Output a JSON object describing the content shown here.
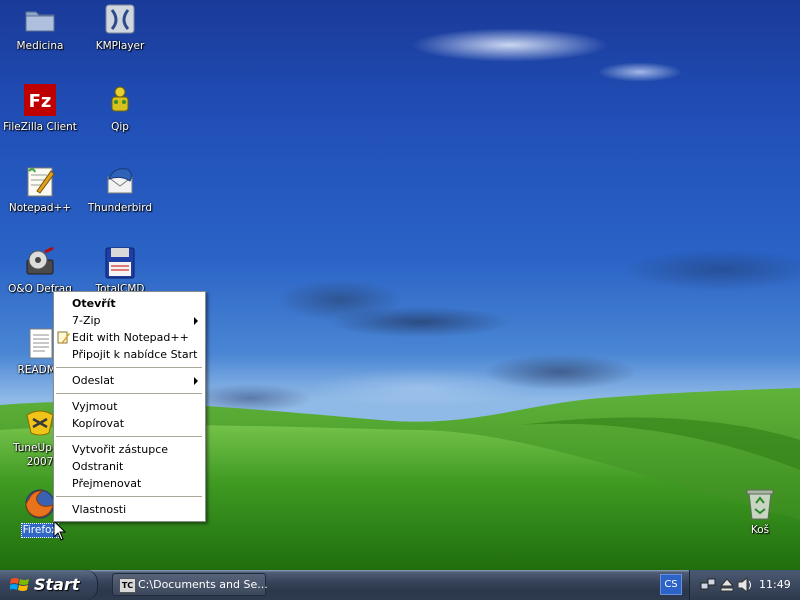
{
  "desktop": {
    "icons": [
      {
        "label": "Medicina",
        "icon": "folder-icon"
      },
      {
        "label": "KMPlayer",
        "icon": "kmplayer-icon"
      },
      {
        "label": "FileZilla Client",
        "icon": "filezilla-icon"
      },
      {
        "label": "Qip",
        "icon": "qip-icon"
      },
      {
        "label": "Notepad++",
        "icon": "notepad-plus-plus-icon"
      },
      {
        "label": "Thunderbird",
        "icon": "thunderbird-icon"
      },
      {
        "label": "O&O Defrag",
        "icon": "defrag-icon"
      },
      {
        "label": "TotalCMD",
        "icon": "floppy-disk-icon"
      },
      {
        "label": "README",
        "icon": "text-document-icon"
      },
      {
        "label": "TuneUp Ut",
        "label2": "2007",
        "icon": "tuneup-icon"
      },
      {
        "label": "Firefox",
        "icon": "firefox-icon"
      },
      {
        "label": "Koš",
        "icon": "recycle-bin-icon"
      }
    ]
  },
  "context_menu": {
    "items": [
      {
        "label": "Otevřít",
        "bold": true
      },
      {
        "label": "7-Zip",
        "submenu": true
      },
      {
        "label": "Edit with Notepad++",
        "icon": "notepad-plus-plus-icon"
      },
      {
        "label": "Připojit k nabídce Start"
      },
      {
        "label": "Odeslat",
        "submenu": true
      },
      {
        "label": "Vyjmout"
      },
      {
        "label": "Kopírovat"
      },
      {
        "label": "Vytvořit zástupce"
      },
      {
        "label": "Odstranit"
      },
      {
        "label": "Přejmenovat"
      },
      {
        "label": "Vlastnosti"
      }
    ]
  },
  "taskbar": {
    "start_label": "Start",
    "tasks": [
      {
        "label": "C:\\Documents and Se...",
        "icon": "total-commander-icon"
      }
    ],
    "language": "CS",
    "clock": "11:49"
  },
  "colors": {
    "selection": "#3167c6",
    "taskbar": "#2b374b",
    "language_badge": "#2c63c8"
  }
}
